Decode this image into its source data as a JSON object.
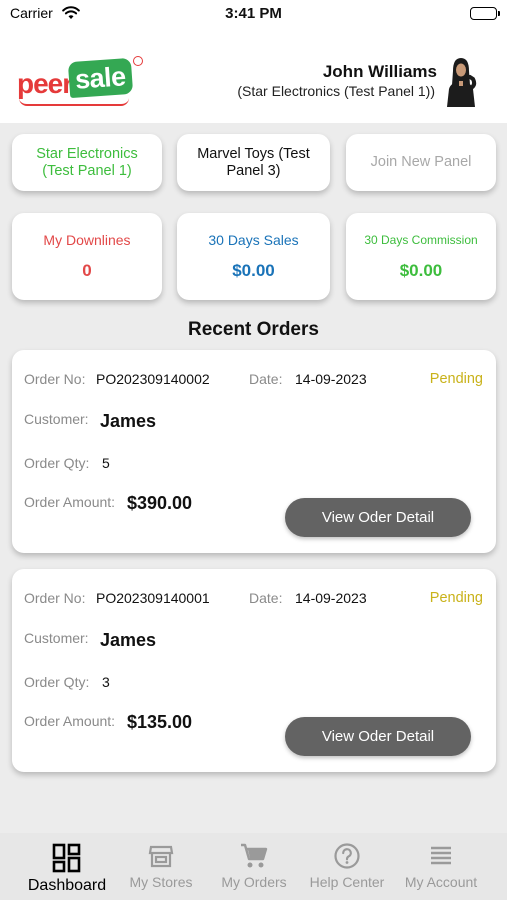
{
  "status_bar": {
    "carrier": "Carrier",
    "time": "3:41 PM"
  },
  "header": {
    "logo": {
      "part1": "peer",
      "part2": "sale"
    },
    "user_name": "John Williams",
    "user_panel": "(Star Electronics (Test Panel 1))"
  },
  "panels": [
    {
      "label": "Star Electronics (Test Panel 1)",
      "state": "active",
      "color": "#3dbd3d"
    },
    {
      "label": "Marvel Toys (Test Panel 3)",
      "state": "default"
    },
    {
      "label": "Join New Panel",
      "state": "disabled"
    }
  ],
  "stats": [
    {
      "label": "My Downlines",
      "value": "0",
      "color": "#e24848"
    },
    {
      "label": "30 Days Sales",
      "value": "$0.00",
      "color": "#1a73b8"
    },
    {
      "label": "30 Days Commission",
      "value": "$0.00",
      "color": "#3dbd3d"
    }
  ],
  "recent_orders": {
    "title": "Recent Orders",
    "labels": {
      "order_no": "Order No:",
      "date": "Date:",
      "customer": "Customer:",
      "qty": "Order Qty:",
      "amount": "Order Amount:"
    },
    "button_label": "View Oder Detail",
    "orders": [
      {
        "order_no": "PO202309140002",
        "date": "14-09-2023",
        "status": "Pending",
        "customer": "James",
        "qty": "5",
        "amount": "$390.00"
      },
      {
        "order_no": "PO202309140001",
        "date": "14-09-2023",
        "status": "Pending",
        "customer": "James",
        "qty": "3",
        "amount": "$135.00"
      }
    ]
  },
  "tabs": [
    {
      "label": "Dashboard",
      "icon": "dashboard-icon",
      "active": true
    },
    {
      "label": "My Stores",
      "icon": "store-icon",
      "active": false
    },
    {
      "label": "My Orders",
      "icon": "cart-icon",
      "active": false
    },
    {
      "label": "Help Center",
      "icon": "help-icon",
      "active": false
    },
    {
      "label": "My Account",
      "icon": "menu-icon",
      "active": false
    }
  ],
  "colors": {
    "accent_green": "#3dbd3d",
    "accent_red": "#e24848",
    "accent_blue": "#1a73b8",
    "pending": "#c9b21a",
    "button": "#636363"
  }
}
